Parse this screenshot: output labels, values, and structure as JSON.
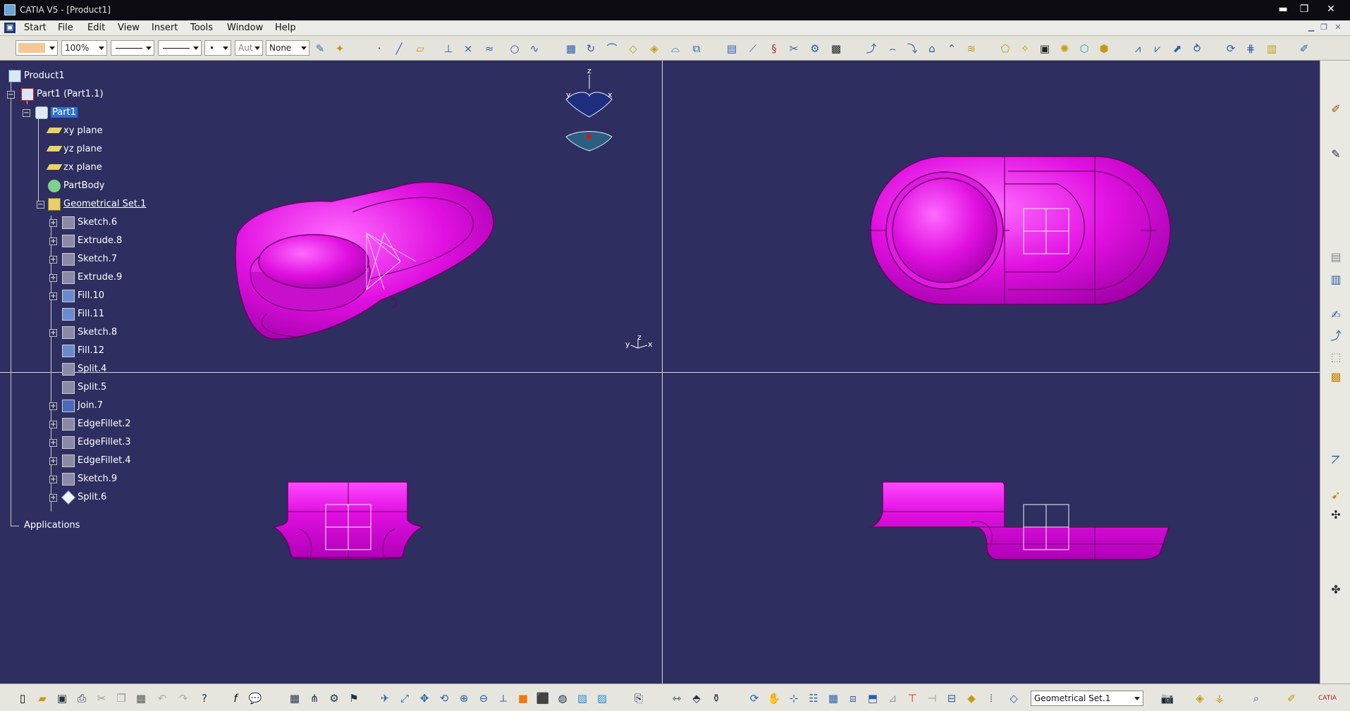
{
  "window": {
    "title": "CATIA V5 - [Product1]",
    "minimize": "▬",
    "restore": "❐",
    "close": "✕"
  },
  "menubar": {
    "items": [
      "Start",
      "File",
      "Edit",
      "View",
      "Insert",
      "Tools",
      "Window",
      "Help"
    ]
  },
  "toolbar": {
    "color_swatch": "#f5c896",
    "zoom_value": "100%",
    "line_weight": "Aut",
    "layer_value": "None"
  },
  "tree": {
    "root": "Product1",
    "part_instance": "Part1 (Part1.1)",
    "part": "Part1",
    "planes": [
      "xy plane",
      "yz plane",
      "zx plane"
    ],
    "body": "PartBody",
    "geom_set": "Geometrical Set.1",
    "features": [
      "Sketch.6",
      "Extrude.8",
      "Sketch.7",
      "Extrude.9",
      "Fill.10",
      "Fill.11",
      "Sketch.8",
      "Fill.12",
      "Split.4",
      "Split.5",
      "Join.7",
      "EdgeFillet.2",
      "EdgeFillet.3",
      "EdgeFillet.4",
      "Sketch.9",
      "Split.6"
    ],
    "applications": "Applications"
  },
  "compass": {
    "z": "z",
    "x": "x",
    "y": "y"
  },
  "axis": {
    "x": "x",
    "y": "y",
    "z": "z"
  },
  "statusbar": {
    "current_set": "Geometrical Set.1"
  },
  "colors": {
    "background": "#2e2e60",
    "part": "#e010e0",
    "part_edge": "#6a006a",
    "selected": "#3070d0"
  }
}
